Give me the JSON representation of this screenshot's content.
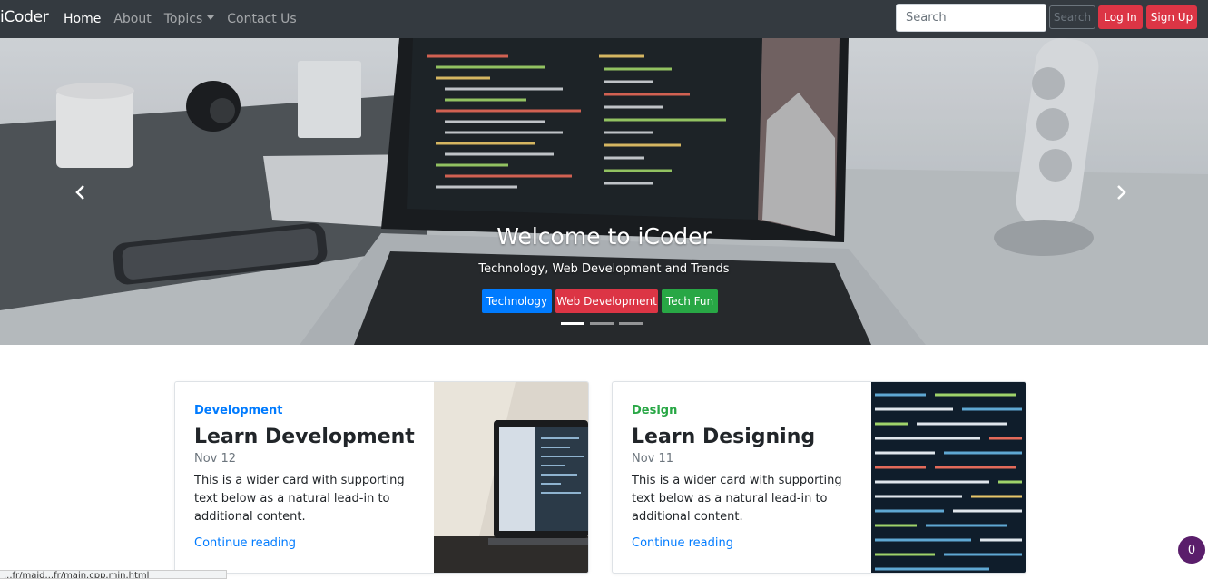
{
  "navbar": {
    "brand": "iCoder",
    "links": [
      {
        "label": "Home"
      },
      {
        "label": "About"
      },
      {
        "label": "Topics"
      },
      {
        "label": "Contact Us"
      }
    ],
    "search_placeholder": "Search",
    "search_button": "Search",
    "login_button": "Log In",
    "signup_button": "Sign Up"
  },
  "carousel": {
    "title": "Welcome to iCoder",
    "subtitle": "Technology, Web Development and Trends",
    "tags": [
      "Technology",
      "Web Development",
      "Tech Fun"
    ],
    "slide_count": 3,
    "active_slide": 1
  },
  "cards": [
    {
      "category": "Development",
      "title": "Learn Development",
      "date": "Nov 12",
      "text": "This is a wider card with supporting text below as a natural lead-in to additional content.",
      "link": "Continue reading",
      "accent": "#007bff"
    },
    {
      "category": "Design",
      "title": "Learn Designing",
      "date": "Nov 11",
      "text": "This is a wider card with supporting text below as a natural lead-in to additional content.",
      "link": "Continue reading",
      "accent": "#28a745"
    }
  ],
  "status_bar": {
    "text": "...fr/maid...fr/main.cpp.min.html"
  },
  "notification_badge": {
    "count": "0"
  },
  "colors": {
    "navbar": "#343a40",
    "primary": "#007bff",
    "danger": "#dc3545",
    "success": "#28a745"
  },
  "icons": [
    "chevron-left-icon",
    "chevron-right-icon"
  ]
}
